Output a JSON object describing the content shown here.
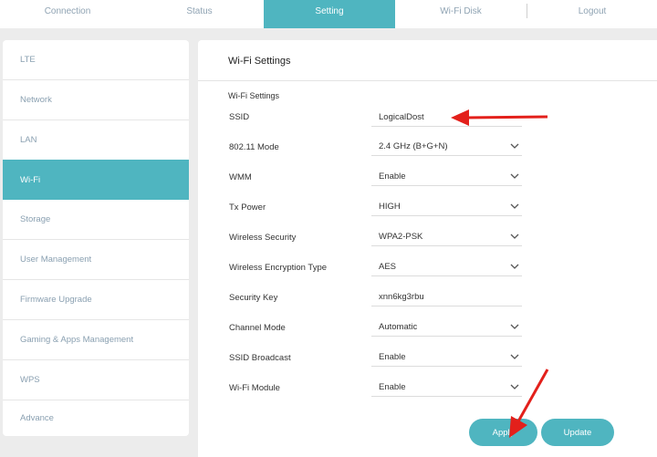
{
  "nav": {
    "tabs": [
      {
        "label": "Connection"
      },
      {
        "label": "Status"
      },
      {
        "label": "Setting"
      },
      {
        "label": "Wi-Fi Disk"
      },
      {
        "label": "Logout"
      }
    ]
  },
  "sidebar": {
    "items": [
      {
        "label": "LTE"
      },
      {
        "label": "Network"
      },
      {
        "label": "LAN"
      },
      {
        "label": "Wi-Fi"
      },
      {
        "label": "Storage"
      },
      {
        "label": "User Management"
      },
      {
        "label": "Firmware Upgrade"
      },
      {
        "label": "Gaming & Apps Management"
      },
      {
        "label": "WPS"
      },
      {
        "label": "Advance"
      }
    ]
  },
  "main": {
    "title": "Wi-Fi Settings",
    "section_label": "Wi-Fi Settings",
    "rows": [
      {
        "label": "SSID",
        "value": "LogicalDost"
      },
      {
        "label": "802.11 Mode",
        "value": "2.4 GHz (B+G+N)"
      },
      {
        "label": "WMM",
        "value": "Enable"
      },
      {
        "label": "Tx Power",
        "value": "HIGH"
      },
      {
        "label": "Wireless Security",
        "value": "WPA2-PSK"
      },
      {
        "label": "Wireless Encryption Type",
        "value": "AES"
      },
      {
        "label": "Security Key",
        "value": "xnn6kg3rbu"
      },
      {
        "label": "Channel Mode",
        "value": "Automatic"
      },
      {
        "label": "SSID Broadcast",
        "value": "Enable"
      },
      {
        "label": "Wi-Fi Module",
        "value": "Enable"
      }
    ],
    "apply_label": "Apply",
    "update_label": "Update"
  },
  "colors": {
    "accent": "#4fb5c0",
    "annotation_arrow": "#e3201b"
  }
}
